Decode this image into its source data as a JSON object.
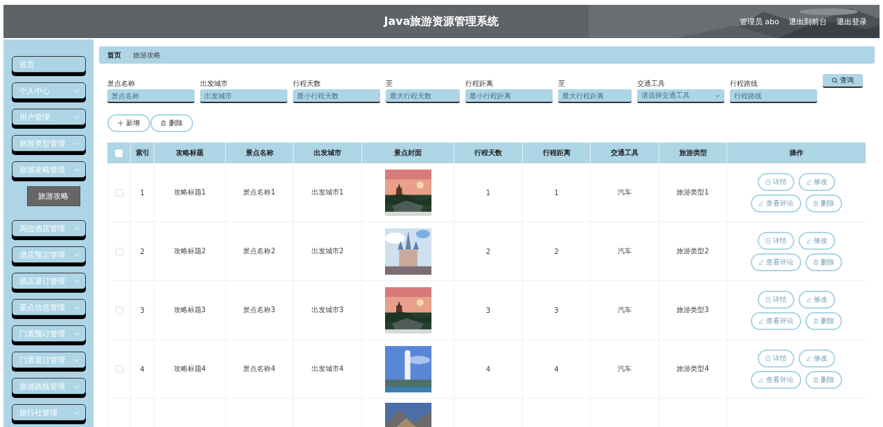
{
  "header": {
    "title": "Java旅游资源管理系统",
    "user": "管理员 abo",
    "links": [
      "退出到前台",
      "退出登录"
    ]
  },
  "sidebar": {
    "items": [
      {
        "label": "首页",
        "expandable": false
      },
      {
        "label": "个人中心",
        "expandable": true
      },
      {
        "label": "用户管理",
        "expandable": true
      },
      {
        "label": "旅游类型管理",
        "expandable": true
      },
      {
        "label": "旅游攻略管理",
        "expandable": true,
        "children": [
          {
            "label": "旅游攻略",
            "selected": true
          }
        ]
      },
      {
        "label": "周边酒店管理",
        "expandable": true
      },
      {
        "label": "酒店预定管理",
        "expandable": true
      },
      {
        "label": "酒店退订管理",
        "expandable": true
      },
      {
        "label": "景点信息管理",
        "expandable": true
      },
      {
        "label": "门票预订管理",
        "expandable": true
      },
      {
        "label": "门票退订管理",
        "expandable": true
      },
      {
        "label": "旅游路线管理",
        "expandable": true
      },
      {
        "label": "旅行社管理",
        "expandable": true
      }
    ]
  },
  "breadcrumb": [
    "首页",
    "旅游攻略"
  ],
  "filters": [
    {
      "label": "景点名称",
      "placeholder": "景点名称",
      "kind": "input"
    },
    {
      "label": "出发城市",
      "placeholder": "出发城市",
      "kind": "input"
    },
    {
      "label": "行程天数",
      "placeholder": "最小行程天数",
      "kind": "input"
    },
    {
      "label": "至",
      "placeholder": "最大行程天数",
      "kind": "input"
    },
    {
      "label": "行程距离",
      "placeholder": "最小行程距离",
      "kind": "input"
    },
    {
      "label": "至",
      "placeholder": "最大行程距离",
      "kind": "input"
    },
    {
      "label": "交通工具",
      "placeholder": "请选择交通工具",
      "kind": "select"
    },
    {
      "label": "行程路线",
      "placeholder": "行程路线",
      "kind": "input"
    }
  ],
  "search_button": "查询",
  "toolbar": [
    "新增",
    "删除"
  ],
  "table": {
    "all_checked": false,
    "columns": [
      "索引",
      "攻略标题",
      "景点名称",
      "出发城市",
      "景点封面",
      "行程天数",
      "行程距离",
      "交通工具",
      "旅游类型",
      "操作"
    ],
    "rows": [
      {
        "checked": false,
        "cells": [
          "1",
          "攻略标题1",
          "景点名称1",
          "出发城市1",
          "",
          "1",
          "1",
          "汽车",
          "旅游类型1"
        ],
        "actions": [
          "详情",
          "修改",
          "查看评论",
          "删除"
        ]
      },
      {
        "checked": false,
        "cells": [
          "2",
          "攻略标题2",
          "景点名称2",
          "出发城市2",
          "",
          "2",
          "2",
          "汽车",
          "旅游类型2"
        ],
        "actions": [
          "详情",
          "修改",
          "查看评论",
          "删除"
        ]
      },
      {
        "checked": false,
        "cells": [
          "3",
          "攻略标题3",
          "景点名称3",
          "出发城市3",
          "",
          "3",
          "3",
          "汽车",
          "旅游类型3"
        ],
        "actions": [
          "详情",
          "修改",
          "查看评论",
          "删除"
        ]
      },
      {
        "checked": false,
        "cells": [
          "4",
          "攻略标题4",
          "景点名称4",
          "出发城市4",
          "",
          "4",
          "4",
          "汽车",
          "旅游类型4"
        ],
        "actions": [
          "详情",
          "修改",
          "查看评论",
          "删除"
        ]
      }
    ]
  }
}
